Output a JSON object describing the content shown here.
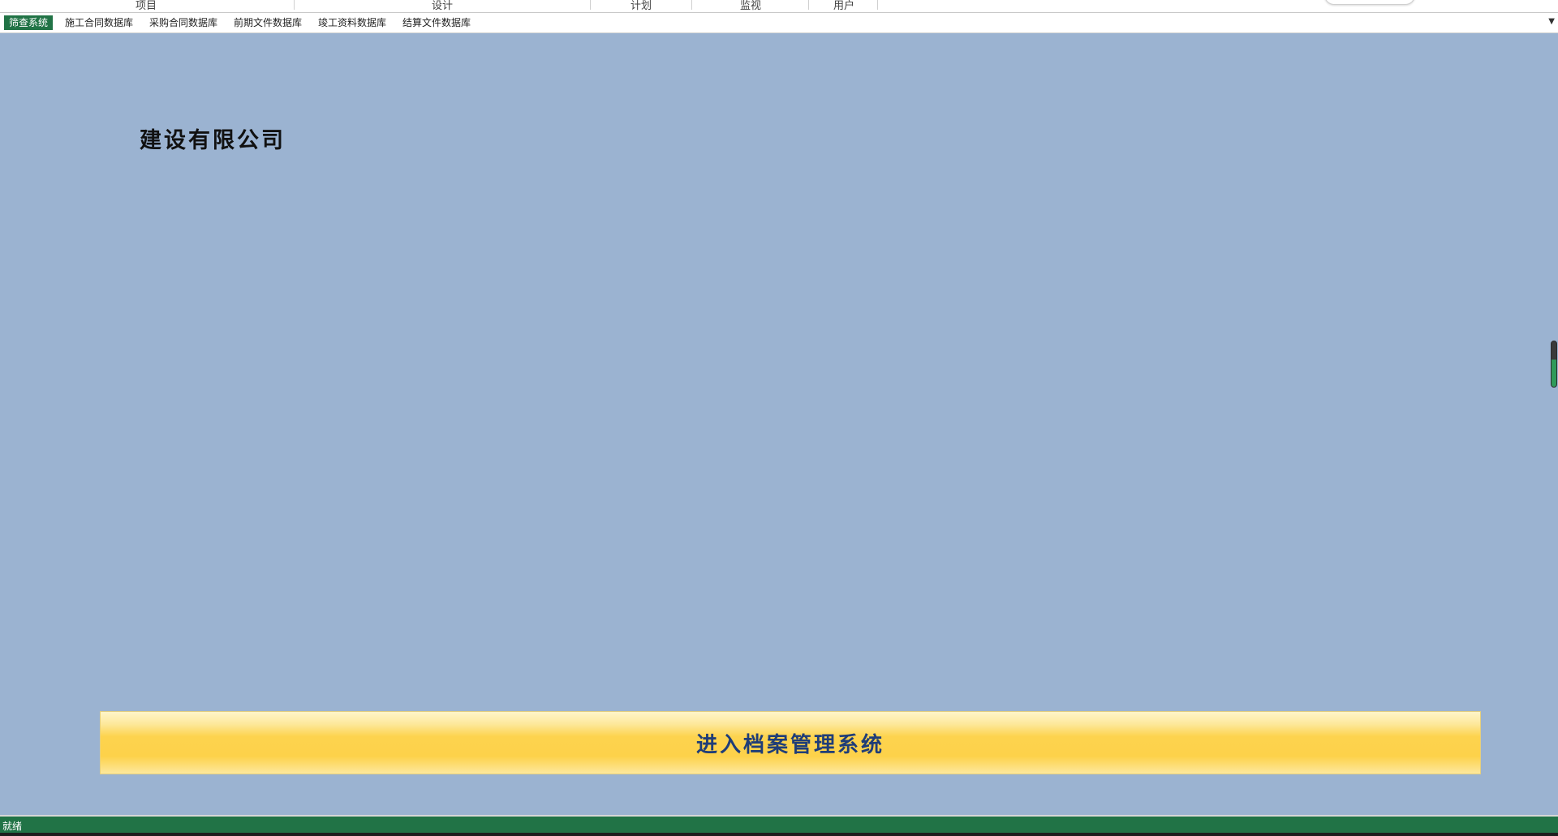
{
  "ribbon": {
    "groups": [
      {
        "label": "项目"
      },
      {
        "label": "设计"
      },
      {
        "label": "计划"
      },
      {
        "label": "监视"
      },
      {
        "label": "用户"
      }
    ]
  },
  "sheet_tabs": [
    {
      "label": "筛查系统",
      "active": true
    },
    {
      "label": "施工合同数据库",
      "active": false
    },
    {
      "label": "采购合同数据库",
      "active": false
    },
    {
      "label": "前期文件数据库",
      "active": false
    },
    {
      "label": "竣工资料数据库",
      "active": false
    },
    {
      "label": "结算文件数据库",
      "active": false
    }
  ],
  "tab_dropdown_icon": "chevron-down-icon",
  "main": {
    "company_name": "建设有限公司",
    "enter_button_label": "进入档案管理系统"
  },
  "status_bar": {
    "status": "就绪"
  },
  "colors": {
    "background": "#9bb3d1",
    "accent": "#217346",
    "button_text": "#1f3d78",
    "button_gold": "#fdd34e"
  }
}
